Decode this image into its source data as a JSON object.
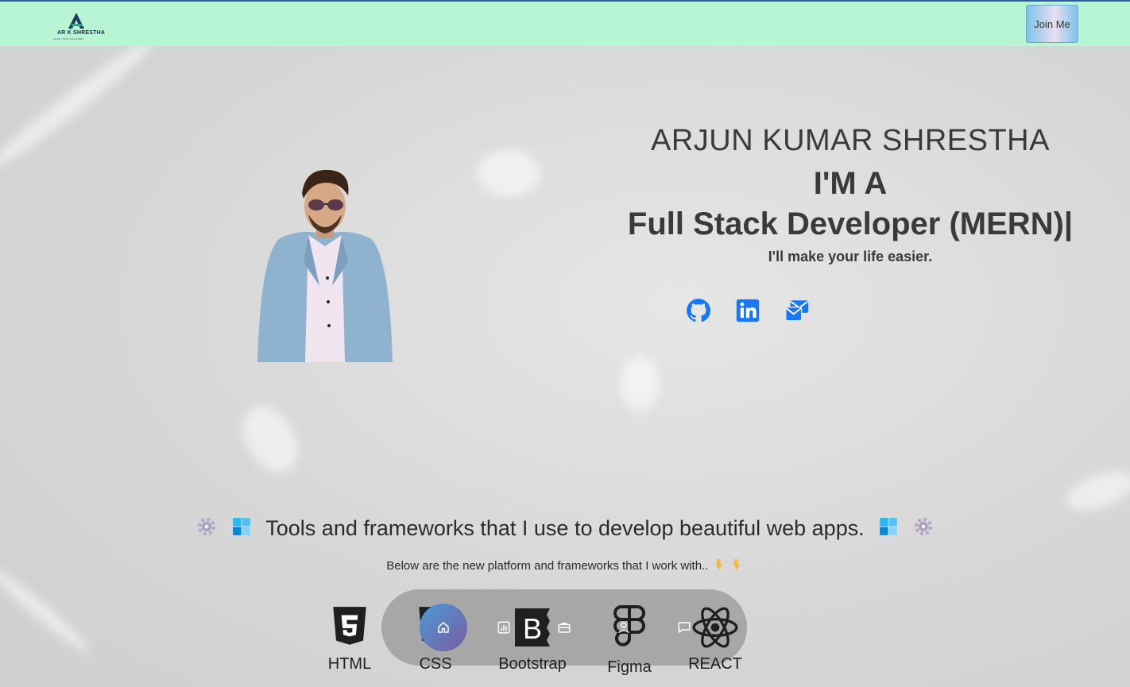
{
  "navbar": {
    "logo_text": "AR K SHRESTHA",
    "logo_sub": "I MAKE YOUR LIFE EASIER",
    "join_label": "Join Me"
  },
  "hero": {
    "name": "ARJUN KUMAR SHRESTHA",
    "intro": "I'M A",
    "role": "Full Stack Developer (MERN)|",
    "tagline": "I'll make your life easier."
  },
  "social": [
    {
      "icon": "github-icon"
    },
    {
      "icon": "linkedin-icon"
    },
    {
      "icon": "mail-icon"
    }
  ],
  "tools": {
    "title": "Tools and frameworks that I use to develop beautiful web apps.",
    "subtitle": "Below are the new platform and frameworks that I work with..",
    "items": [
      {
        "label": "HTML",
        "icon": "html5-icon"
      },
      {
        "label": "CSS",
        "icon": "css3-icon"
      },
      {
        "label": "Bootstrap",
        "icon": "bootstrap-icon"
      },
      {
        "label": "Figma",
        "icon": "figma-icon"
      },
      {
        "label": "REACT",
        "icon": "react-icon"
      }
    ]
  },
  "dock": {
    "items": [
      "home-icon",
      "chart-icon",
      "briefcase-icon",
      "user-icon",
      "chat-icon"
    ]
  },
  "colors": {
    "navbar": "#b8f5d4",
    "accent": "#1877f2",
    "text": "#3a3a3a"
  }
}
